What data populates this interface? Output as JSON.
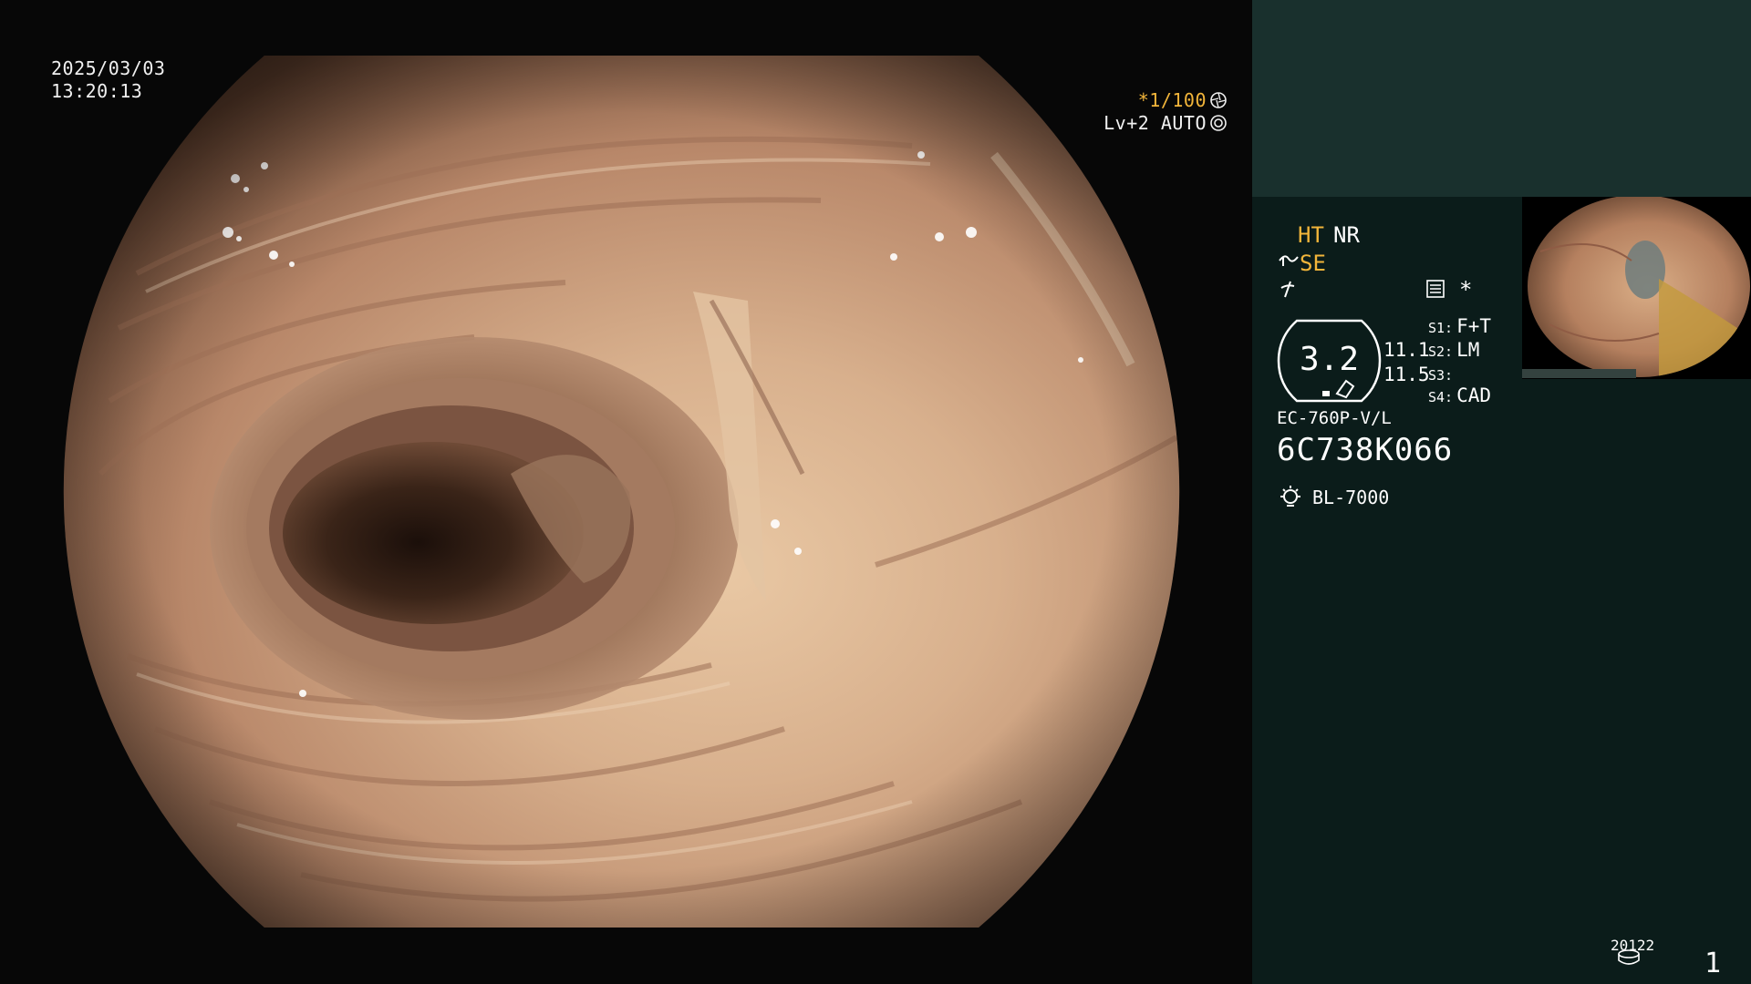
{
  "overlay": {
    "date": "2025/03/03",
    "time": "13:20:13",
    "shutter_marker": "*",
    "shutter_speed": "1/100",
    "level": "Lv+2",
    "auto_mode": "AUTO"
  },
  "panel": {
    "ht": "HT",
    "nr": "NR",
    "se": "SE",
    "star": "*",
    "gauge_value": "3.2",
    "value_1": "11.1",
    "value_2": "11.5",
    "slots": [
      {
        "key": "S1:",
        "value": "F+T"
      },
      {
        "key": "S2:",
        "value": "LM"
      },
      {
        "key": "S3:",
        "value": ""
      },
      {
        "key": "S4:",
        "value": "CAD"
      }
    ],
    "scope_model": "EC-760P-V/L",
    "serial": "6C738K066",
    "light_source": "BL-7000",
    "counter": "20122",
    "page_number": "1"
  },
  "icons": {
    "shutter": "aperture-icon",
    "auto": "iris-icon",
    "se": "structure-enhance-icon",
    "nf": "noise-filter-icon",
    "menu": "menu-icon",
    "light": "light-bulb-icon",
    "counter": "disk-icon"
  },
  "colors": {
    "accent": "#f2b53a",
    "panel_bg": "#0b1c1a",
    "panel_header": "#19302d",
    "tissue": "#c79a7c"
  }
}
